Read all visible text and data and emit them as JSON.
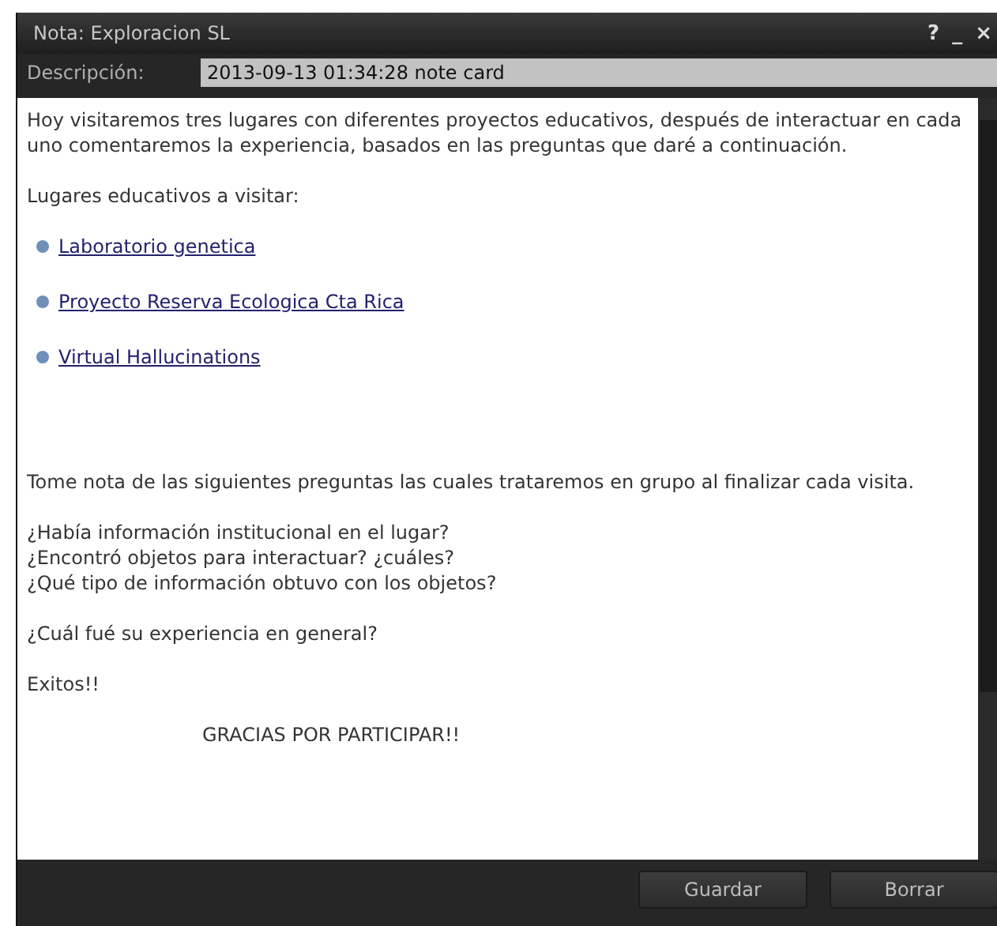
{
  "window": {
    "title": "Nota: Exploracion SL",
    "controls": [
      "?",
      "_",
      "×"
    ]
  },
  "description": {
    "label": "Descripción:",
    "value": "2013-09-13 01:34:28 note card"
  },
  "note": [
    {
      "kind": "paragraph",
      "text": "Hoy visitaremos tres lugares con diferentes proyectos educativos, después de interactuar en cada uno comentaremos  la experiencia, basados en las preguntas que daré a continuación."
    },
    {
      "kind": "paragraph",
      "text": "Lugares educativos a visitar:"
    },
    {
      "kind": "link",
      "text": "Laboratorio genetica"
    },
    {
      "kind": "link",
      "text": "Proyecto Reserva Ecologica Cta Rica"
    },
    {
      "kind": "link",
      "text": "Virtual Hallucinations"
    },
    {
      "kind": "paragraph",
      "text": "Tome nota de las siguientes preguntas las cuales trataremos en grupo al finalizar  cada visita."
    },
    {
      "kind": "lines",
      "lines": [
        "¿Había información institucional en el lugar?",
        "¿Encontró objetos para interactuar? ¿cuáles?",
        "¿Qué tipo de información obtuvo con los objetos?"
      ]
    },
    {
      "kind": "paragraph",
      "text": "¿Cuál fué su experiencia en general?"
    },
    {
      "kind": "paragraph",
      "text": "Exitos!!"
    },
    {
      "kind": "centered",
      "text": "GRACIAS POR PARTICIPAR!!"
    }
  ],
  "buttons": [
    "Guardar",
    "Borrar"
  ]
}
